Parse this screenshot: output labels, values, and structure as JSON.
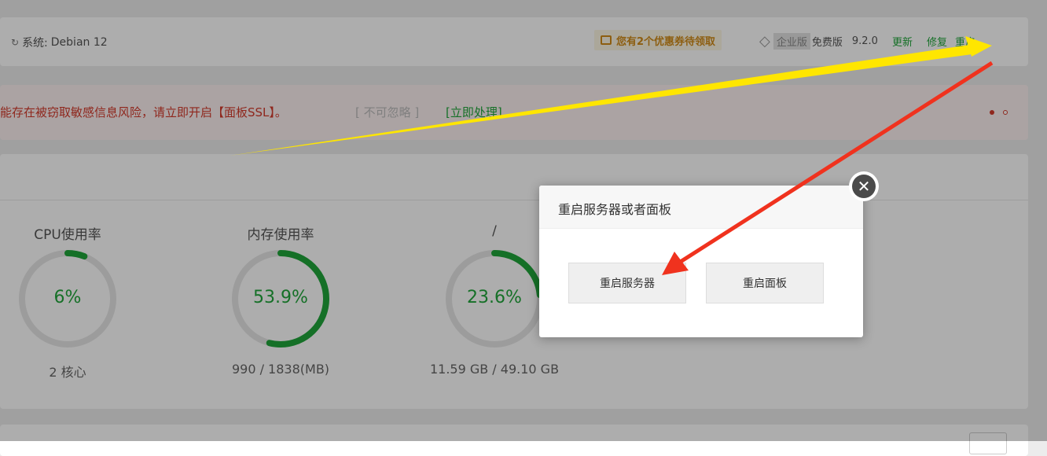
{
  "header": {
    "system_label": "系统:",
    "system_value": "Debian 12",
    "coupon_text": "您有2个优惠券待领取",
    "enterprise_label": "企业版",
    "free_label": "免费版",
    "version": "9.2.0",
    "update_label": "更新",
    "repair_label": "修复",
    "restart_label": "重启"
  },
  "alert": {
    "message": "能存在被窃取敏感信息风险，请立即开启【面板SSL】。",
    "ignore_label": "[ 不可忽略 ]",
    "handle_label": "[立即处理]"
  },
  "gauges": [
    {
      "title": "CPU使用率",
      "value": "6%",
      "percent": 6,
      "sub": "2 核心"
    },
    {
      "title": "内存使用率",
      "value": "53.9%",
      "percent": 53.9,
      "sub": "990 / 1838(MB)"
    },
    {
      "title": "/",
      "value": "23.6%",
      "percent": 23.6,
      "sub": "11.59 GB / 49.10 GB"
    }
  ],
  "dialog": {
    "title": "重启服务器或者面板",
    "restart_server_label": "重启服务器",
    "restart_panel_label": "重启面板"
  },
  "colors": {
    "accent_green": "#20a53a",
    "alert_red": "#d33a2c",
    "coupon_orange": "#d08b18",
    "annotation_yellow": "#ffe600",
    "annotation_red": "#f0321e"
  }
}
